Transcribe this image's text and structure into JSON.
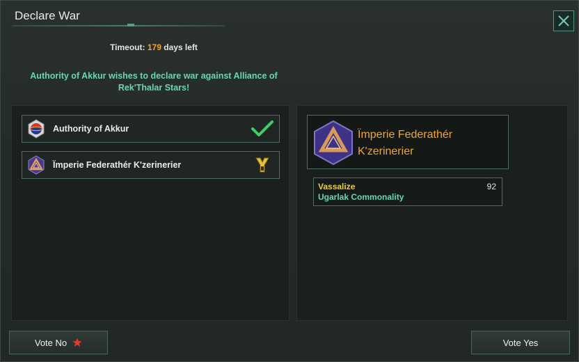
{
  "window": {
    "title": "Declare War"
  },
  "timeout": {
    "label": "Timeout:",
    "days": "179",
    "suffix": "days left"
  },
  "announcement": "Authority of Akkur wishes to declare war against Alliance of Rek'Thalar Stars!",
  "voters": [
    {
      "name": "Authority of Akkur",
      "status": "voted-yes",
      "status_icon": "checkmark-icon",
      "emblem": "red-blue-sphere-emblem"
    },
    {
      "name": "Ïmperie Federathér K'zerinerier",
      "status": "pending",
      "status_icon": "yellow-y-icon",
      "emblem": "purple-triangle-emblem"
    }
  ],
  "target": {
    "name": "Ïmperie Federathér K'zerinerier",
    "emblem": "purple-triangle-emblem"
  },
  "demand": {
    "type": "Vassalize",
    "value": "92",
    "target": "Ugarlak Commonality"
  },
  "buttons": {
    "vote_no": "Vote No",
    "vote_yes": "Vote Yes"
  },
  "colors": {
    "accent_teal": "#68d6b4",
    "accent_orange": "#f0a53a",
    "accent_yellow": "#e8cf47",
    "check_green": "#3fcf63",
    "star_red": "#e23b2a"
  }
}
